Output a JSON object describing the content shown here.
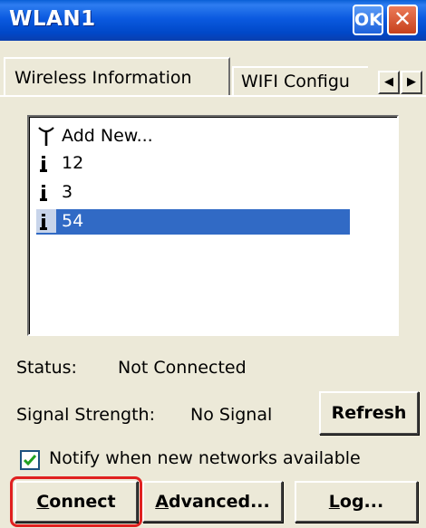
{
  "window": {
    "title": "WLAN1",
    "ok_label": "OK",
    "close_label": "✕"
  },
  "tabs": [
    {
      "label": "Wireless Information",
      "active": true
    },
    {
      "label": "WIFI Configu",
      "active": false
    }
  ],
  "tab_scroll": {
    "prev": "◀",
    "next": "▶"
  },
  "networks": [
    {
      "label": "Add New...",
      "icon": "antenna-icon",
      "selected": false
    },
    {
      "label": "12",
      "icon": "network-signal-icon",
      "selected": false
    },
    {
      "label": "3",
      "icon": "network-signal-icon",
      "selected": false
    },
    {
      "label": "54",
      "icon": "network-signal-icon",
      "selected": true
    }
  ],
  "status": {
    "label": "Status:",
    "value": "Not Connected"
  },
  "signal": {
    "label": "Signal Strength:",
    "value": "No Signal"
  },
  "refresh_label": "Refresh",
  "notify": {
    "label": "Notify when new networks available",
    "checked": true
  },
  "buttons": {
    "connect": {
      "accel": "C",
      "rest": "onnect"
    },
    "advanced": {
      "accel": "A",
      "rest": "dvanced..."
    },
    "log": {
      "accel": "L",
      "rest": "og..."
    }
  },
  "colors": {
    "titlebar": "#0054e3",
    "selection": "#316ac5",
    "highlight": "#e02020",
    "checkmark": "#21a121"
  }
}
